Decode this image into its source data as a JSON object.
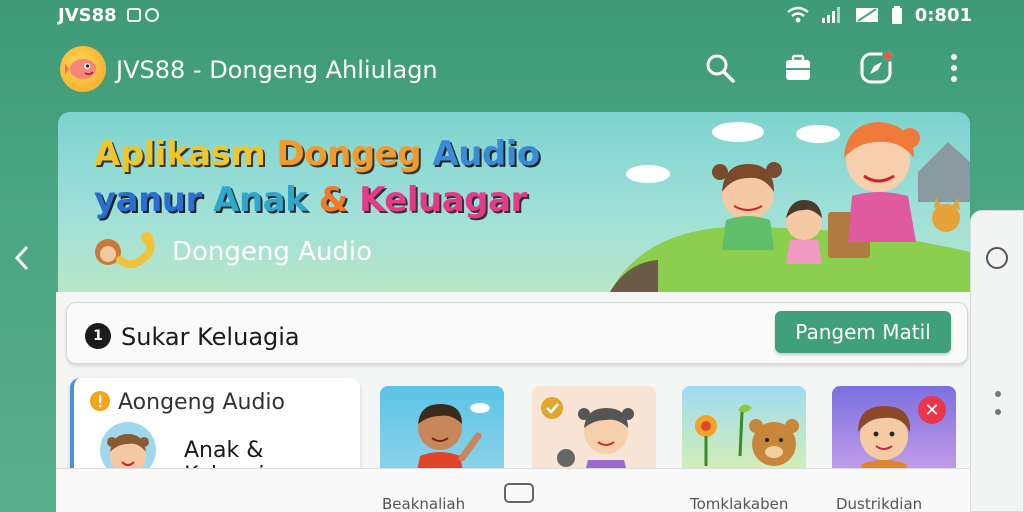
{
  "status_bar": {
    "carrier": "JVS88",
    "time": "0:801"
  },
  "app_bar": {
    "title": "JVS88 - Dongeng Ahliulagn",
    "icons": [
      "search-icon",
      "briefcase-icon",
      "compass-icon",
      "more-vert-icon"
    ]
  },
  "banner": {
    "line1_words": [
      "Aplikasm",
      "Dongeg",
      "Audio"
    ],
    "line2_words": [
      "yanur",
      "Anak",
      "&",
      "Keluagar"
    ],
    "subtitle": "Dongeng Audio"
  },
  "category_bar": {
    "label": "Sukar Keluagia",
    "icon_glyph": "1",
    "button_label": "Pangem Matil"
  },
  "feature_card": {
    "title": "Aongeng Audio",
    "subtitle": "Anak & Keluagia"
  },
  "bottom_nav": {
    "items": [
      "Beaknaliah",
      "Tomklakaben",
      "Dustrikdian"
    ]
  },
  "colors": {
    "primary": "#4aa582",
    "accent_button": "#3fa07b",
    "close_badge": "#e8364a"
  }
}
